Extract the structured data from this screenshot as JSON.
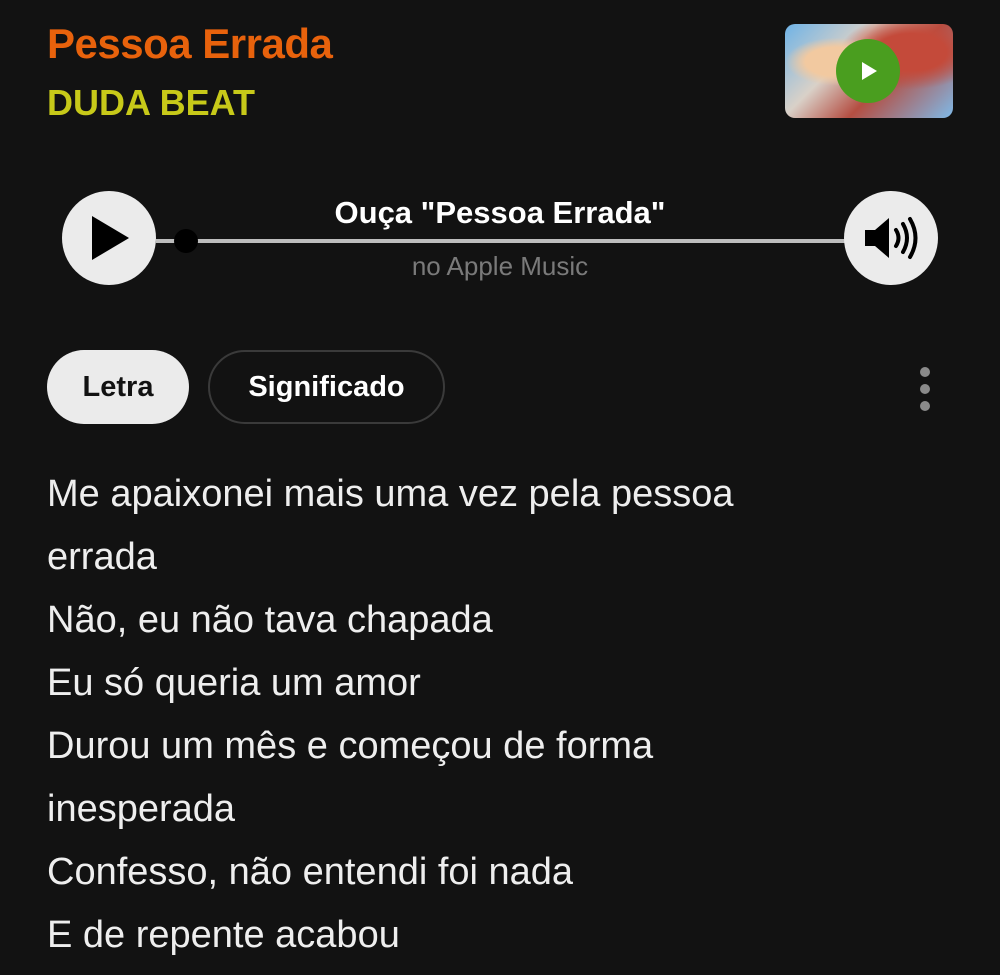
{
  "song": {
    "title": "Pessoa Errada",
    "artist": "DUDA BEAT"
  },
  "player": {
    "listen_title": "Ouça \"Pessoa Errada\"",
    "listen_subtitle": "no Apple Music"
  },
  "tabs": [
    {
      "label": "Letra",
      "active": true
    },
    {
      "label": "Significado",
      "active": false
    }
  ],
  "lyrics": [
    "Me apaixonei mais uma vez pela pessoa",
    "errada",
    "Não, eu não tava chapada",
    "Eu só queria um amor",
    "Durou um mês e começou de forma",
    "inesperada",
    "Confesso, não entendi foi nada",
    "E de repente acabou"
  ],
  "colors": {
    "background": "#121212",
    "title": "#e8620c",
    "artist": "#c7c919",
    "thumb_play": "#4a9e1f"
  },
  "icons": [
    "play-icon",
    "volume-icon",
    "more-vertical-icon"
  ]
}
